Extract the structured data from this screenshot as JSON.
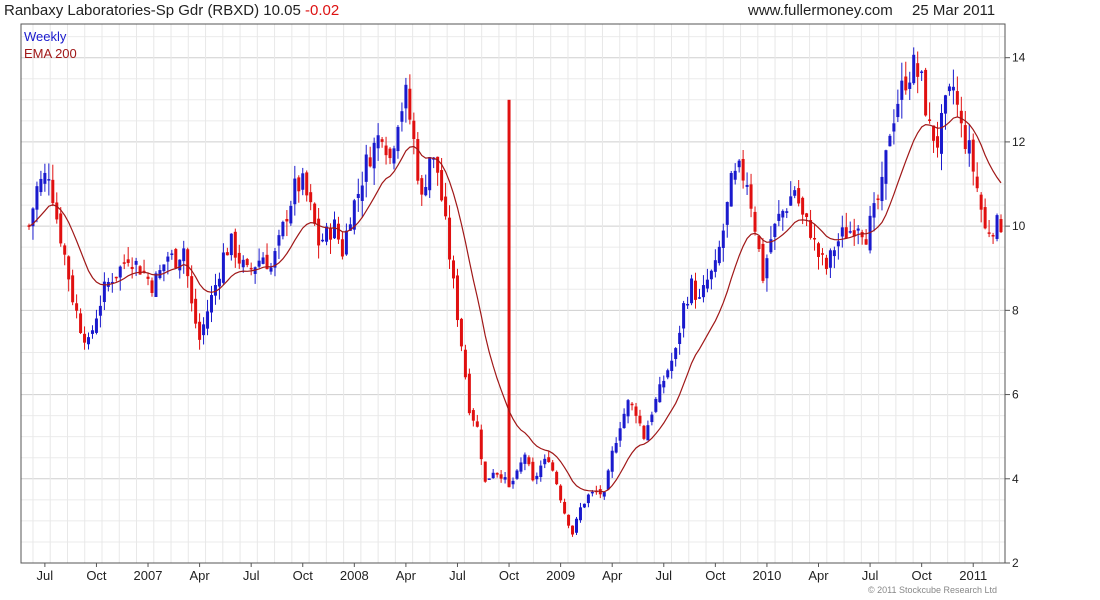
{
  "header": {
    "title": "Ranbaxy Laboratories-Sp Gdr (RBXD) 10.05",
    "change": "-0.02",
    "site": "www.fullermoney.com",
    "date": "25 Mar 2011"
  },
  "footer": {
    "copyright": "© 2011 Stockcube Research Ltd"
  },
  "colors": {
    "up": "#1a1acd",
    "down": "#e01010",
    "ema": "#a01818",
    "grid": "#d8d8d8",
    "axis": "#555555"
  },
  "chart_data": {
    "type": "candlestick",
    "title": "Ranbaxy Laboratories-Sp Gdr (RBXD)",
    "legend": [
      "Weekly",
      "EMA 200"
    ],
    "legend_position": "top-left",
    "ylim": [
      2,
      14.8
    ],
    "y_ticks": [
      2,
      4,
      6,
      8,
      10,
      12,
      14
    ],
    "grid": true,
    "x_tick_labels": [
      "Jul",
      "Oct",
      "2007",
      "Apr",
      "Jul",
      "Oct",
      "2008",
      "Apr",
      "Jul",
      "Oct",
      "2009",
      "Apr",
      "Jul",
      "Oct",
      "2010",
      "Apr",
      "Jul",
      "Oct",
      "2011"
    ],
    "price_anchors": [
      [
        0,
        10.0
      ],
      [
        2,
        10.9
      ],
      [
        5,
        11.3
      ],
      [
        7,
        10.2
      ],
      [
        9,
        9.3
      ],
      [
        11,
        8.3
      ],
      [
        13,
        7.6
      ],
      [
        15,
        7.2
      ],
      [
        17,
        7.9
      ],
      [
        19,
        8.5
      ],
      [
        21,
        8.8
      ],
      [
        23,
        9.0
      ],
      [
        25,
        9.3
      ],
      [
        27,
        9.1
      ],
      [
        29,
        8.9
      ],
      [
        31,
        8.6
      ],
      [
        33,
        8.9
      ],
      [
        35,
        9.3
      ],
      [
        37,
        9.2
      ],
      [
        39,
        9.5
      ],
      [
        41,
        8.1
      ],
      [
        43,
        7.3
      ],
      [
        45,
        8.0
      ],
      [
        47,
        8.6
      ],
      [
        49,
        9.3
      ],
      [
        51,
        9.6
      ],
      [
        53,
        9.2
      ],
      [
        55,
        8.9
      ],
      [
        57,
        9.1
      ],
      [
        59,
        9.3
      ],
      [
        61,
        9.0
      ],
      [
        63,
        9.6
      ],
      [
        65,
        10.3
      ],
      [
        67,
        10.9
      ],
      [
        69,
        11.0
      ],
      [
        71,
        10.4
      ],
      [
        73,
        9.6
      ],
      [
        75,
        9.8
      ],
      [
        77,
        10.0
      ],
      [
        79,
        9.4
      ],
      [
        81,
        10.3
      ],
      [
        83,
        10.8
      ],
      [
        85,
        11.5
      ],
      [
        87,
        11.9
      ],
      [
        89,
        12.3
      ],
      [
        91,
        11.6
      ],
      [
        93,
        12.6
      ],
      [
        95,
        13.1
      ],
      [
        97,
        12.0
      ],
      [
        99,
        10.6
      ],
      [
        101,
        11.7
      ],
      [
        103,
        11.3
      ],
      [
        105,
        10.0
      ],
      [
        107,
        8.6
      ],
      [
        109,
        7.2
      ],
      [
        111,
        5.7
      ],
      [
        113,
        5.2
      ],
      [
        115,
        3.9
      ],
      [
        117,
        4.2
      ],
      [
        119,
        4.1
      ],
      [
        121,
        3.8
      ],
      [
        123,
        4.1
      ],
      [
        125,
        4.6
      ],
      [
        127,
        3.9
      ],
      [
        129,
        4.3
      ],
      [
        131,
        4.5
      ],
      [
        133,
        3.9
      ],
      [
        135,
        3.2
      ],
      [
        137,
        2.7
      ],
      [
        139,
        3.3
      ],
      [
        141,
        3.6
      ],
      [
        143,
        3.7
      ],
      [
        145,
        3.6
      ],
      [
        147,
        4.6
      ],
      [
        149,
        5.3
      ],
      [
        151,
        5.8
      ],
      [
        153,
        5.6
      ],
      [
        155,
        5.0
      ],
      [
        157,
        5.6
      ],
      [
        159,
        6.1
      ],
      [
        161,
        6.6
      ],
      [
        163,
        7.0
      ],
      [
        165,
        8.1
      ],
      [
        167,
        8.6
      ],
      [
        169,
        8.2
      ],
      [
        171,
        8.7
      ],
      [
        173,
        9.0
      ],
      [
        175,
        9.9
      ],
      [
        177,
        11.0
      ],
      [
        179,
        11.3
      ],
      [
        181,
        11.1
      ],
      [
        183,
        10.0
      ],
      [
        185,
        8.8
      ],
      [
        187,
        9.7
      ],
      [
        189,
        10.2
      ],
      [
        191,
        10.5
      ],
      [
        193,
        10.9
      ],
      [
        195,
        10.2
      ],
      [
        197,
        9.9
      ],
      [
        199,
        9.3
      ],
      [
        201,
        9.0
      ],
      [
        203,
        9.5
      ],
      [
        205,
        9.8
      ],
      [
        207,
        9.9
      ],
      [
        209,
        10.1
      ],
      [
        211,
        9.8
      ],
      [
        213,
        10.3
      ],
      [
        215,
        10.9
      ],
      [
        217,
        12.3
      ],
      [
        219,
        13.0
      ],
      [
        221,
        13.5
      ],
      [
        223,
        13.8
      ],
      [
        225,
        13.4
      ],
      [
        227,
        12.3
      ],
      [
        229,
        12.0
      ],
      [
        231,
        12.8
      ],
      [
        233,
        13.3
      ],
      [
        235,
        12.3
      ],
      [
        237,
        11.8
      ],
      [
        239,
        10.9
      ],
      [
        241,
        9.9
      ],
      [
        243,
        10.0
      ],
      [
        245,
        10.05
      ]
    ],
    "spikes": [
      {
        "week": 121,
        "high": 13.0,
        "low": 3.8
      }
    ],
    "last_close": 10.05
  }
}
